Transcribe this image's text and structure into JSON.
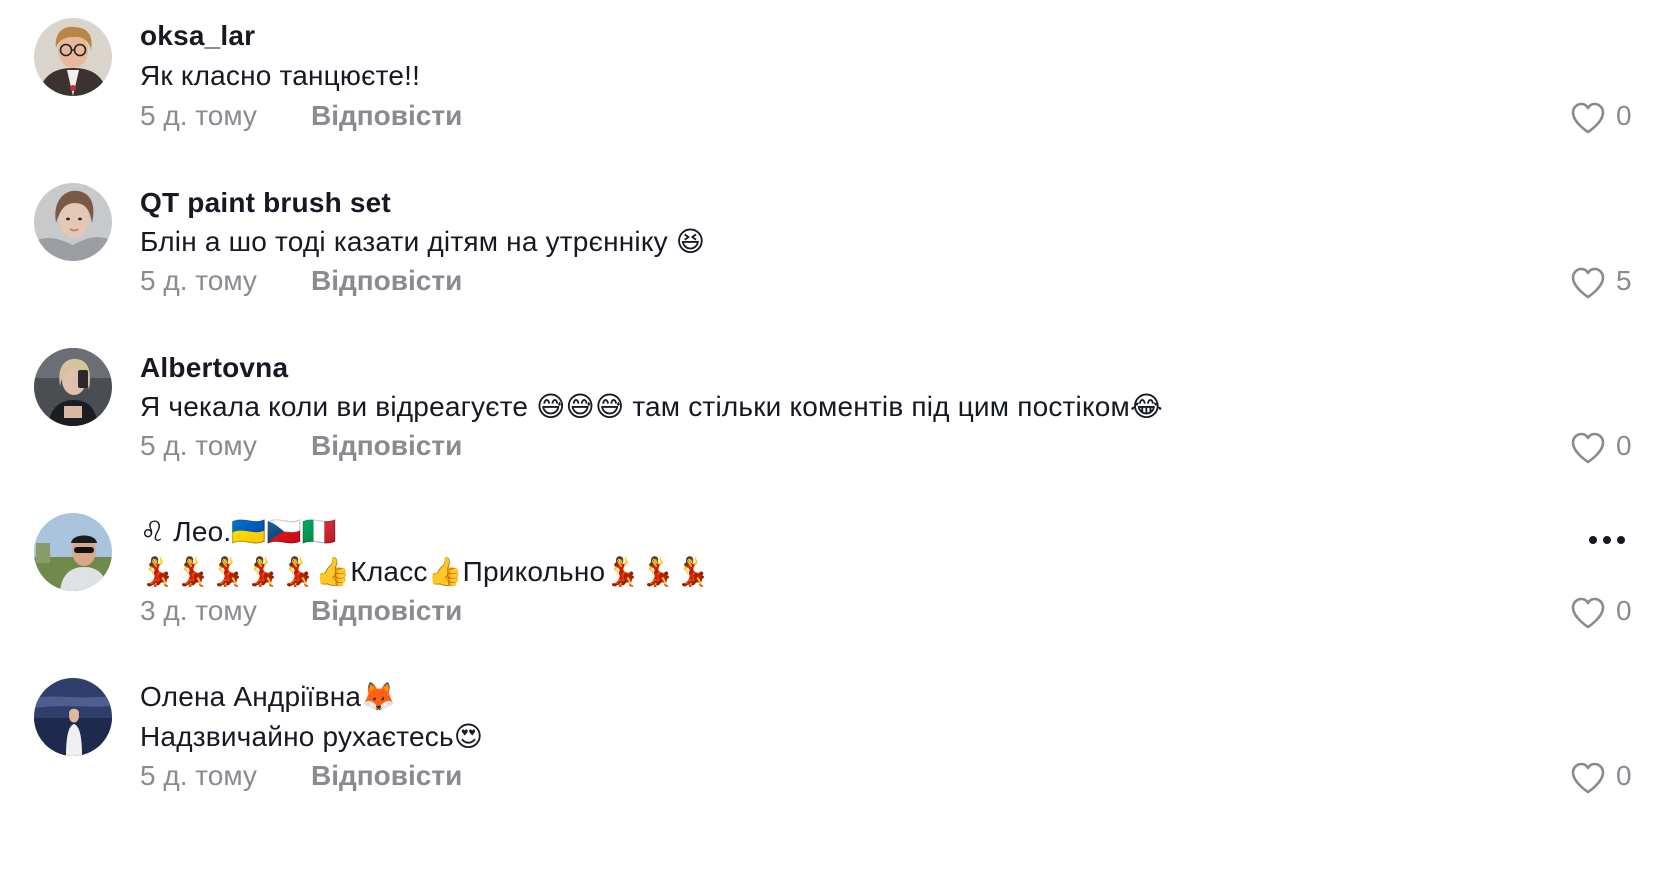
{
  "comments": [
    {
      "username": "oksa_lar",
      "text": "Як класно танцюєте!!",
      "time": "5 д. тому",
      "reply_label": "Відповісти",
      "likes": "0",
      "avatar_icon": "avatar-photo"
    },
    {
      "username": "QT paint brush set",
      "text": "Блін а шо тоді казати дітям на утрєнніку 😆",
      "time": "5 д. тому",
      "reply_label": "Відповісти",
      "likes": "5",
      "avatar_icon": "avatar-photo"
    },
    {
      "username": "Albertovna",
      "text": "Я чекала коли ви відреагуєте 😅😅😅 там стільки коментів під цим постіком😂",
      "time": "5 д. тому",
      "reply_label": "Відповісти",
      "likes": "0",
      "avatar_icon": "avatar-photo"
    },
    {
      "username": "♌ Лео.🇺🇦🇨🇿🇮🇹",
      "text": "💃💃💃💃💃👍Класс👍Прикольно💃💃💃",
      "time": "3 д. тому",
      "reply_label": "Відповісти",
      "likes": "0",
      "avatar_icon": "avatar-photo",
      "more_icon": "more-options-icon"
    },
    {
      "username": "Олена Андріївна🦊",
      "text": "Надзвичайно рухаєтесь😍",
      "time": "5 д. тому",
      "reply_label": "Відповісти",
      "likes": "0",
      "avatar_icon": "avatar-photo"
    }
  ],
  "colors": {
    "text": "#161823",
    "secondary": "#8a8b91",
    "background": "#ffffff"
  }
}
